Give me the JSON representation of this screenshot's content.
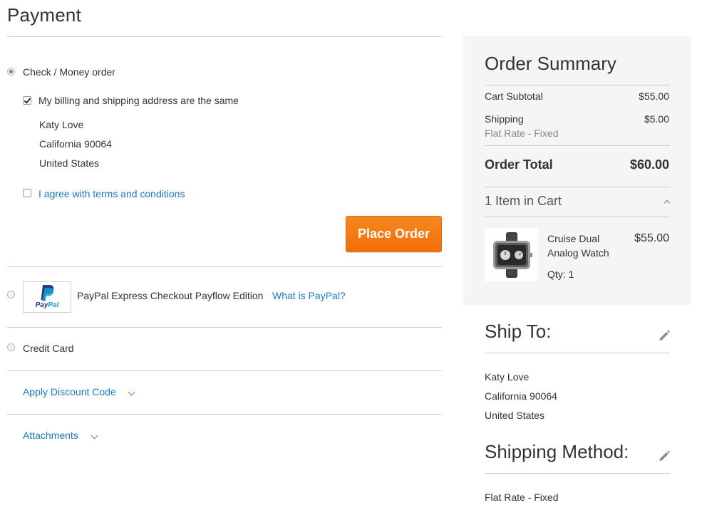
{
  "payment": {
    "title": "Payment",
    "check_money_order": {
      "label": "Check / Money order",
      "billing_same_label": "My billing and shipping address are the same",
      "address": {
        "name": "Katy Love",
        "region_zip": "California 90064",
        "country": "United States"
      },
      "agree_label": "I agree with terms and conditions",
      "place_order_label": "Place Order"
    },
    "paypal": {
      "logo_text": "PayPal",
      "logo_text_a": "Pay",
      "logo_text_b": "Pal",
      "label": "PayPal Express Checkout Payflow Edition",
      "what_is_link": "What is PayPal?"
    },
    "credit_card": {
      "label": "Credit Card"
    },
    "discount": {
      "label": "Apply Discount Code"
    },
    "attachments": {
      "label": "Attachments"
    }
  },
  "order_summary": {
    "title": "Order Summary",
    "cart_subtotal_label": "Cart Subtotal",
    "cart_subtotal_value": "$55.00",
    "shipping_label": "Shipping",
    "shipping_value": "$5.00",
    "shipping_method": "Flat Rate - Fixed",
    "order_total_label": "Order Total",
    "order_total_value": "$60.00",
    "items_in_cart": "1 Item in Cart",
    "item": {
      "name_line1": "Cruise Dual",
      "name_line2": "Analog Watch",
      "price": "$55.00",
      "qty_label": "Qty: 1"
    }
  },
  "ship_to": {
    "title": "Ship To:",
    "name": "Katy Love",
    "region_zip": "California 90064",
    "country": "United States"
  },
  "shipping_method": {
    "title": "Shipping Method:",
    "value": "Flat Rate - Fixed"
  },
  "colors": {
    "link": "#1979c3",
    "button": "#f1700b",
    "summary_bg": "#f5f5f5"
  }
}
